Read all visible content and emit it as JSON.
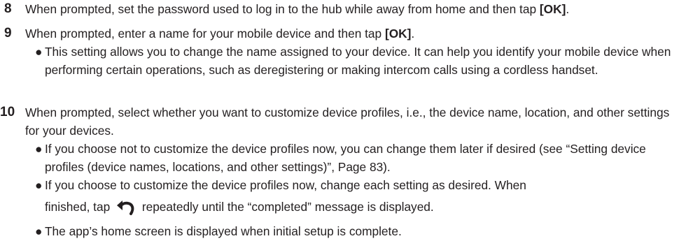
{
  "steps": [
    {
      "number": "8",
      "text_before": "When prompted, set the password used to log in to the hub while away from home and then tap ",
      "emphasis": "[OK]",
      "text_after": "."
    },
    {
      "number": "9",
      "text_before": "When prompted, enter a name for your mobile device and then tap ",
      "emphasis": "[OK]",
      "text_after": ".",
      "bullets": [
        "This setting allows you to change the name assigned to your device. It can help you identify your mobile device when performing certain operations, such as deregistering or making intercom calls using a cordless handset."
      ]
    },
    {
      "number": "10",
      "text": "When prompted, select whether you want to customize device profiles, i.e., the device name, location, and other settings for your devices.",
      "bullets": [
        "If you choose not to customize the device profiles now, you can change them later if desired (see “Setting device profiles (device names, locations, and other settings)”, Page 83).",
        "If you choose to customize the device profiles now, change each setting as desired. When",
        "finished, tap",
        "repeatedly until the “completed” message is displayed.",
        "The app’s home screen is displayed when initial setup is complete."
      ]
    }
  ],
  "bullet_char": "●",
  "icons": {
    "back": "back-arrow-icon",
    "back_color": "#231f20"
  }
}
